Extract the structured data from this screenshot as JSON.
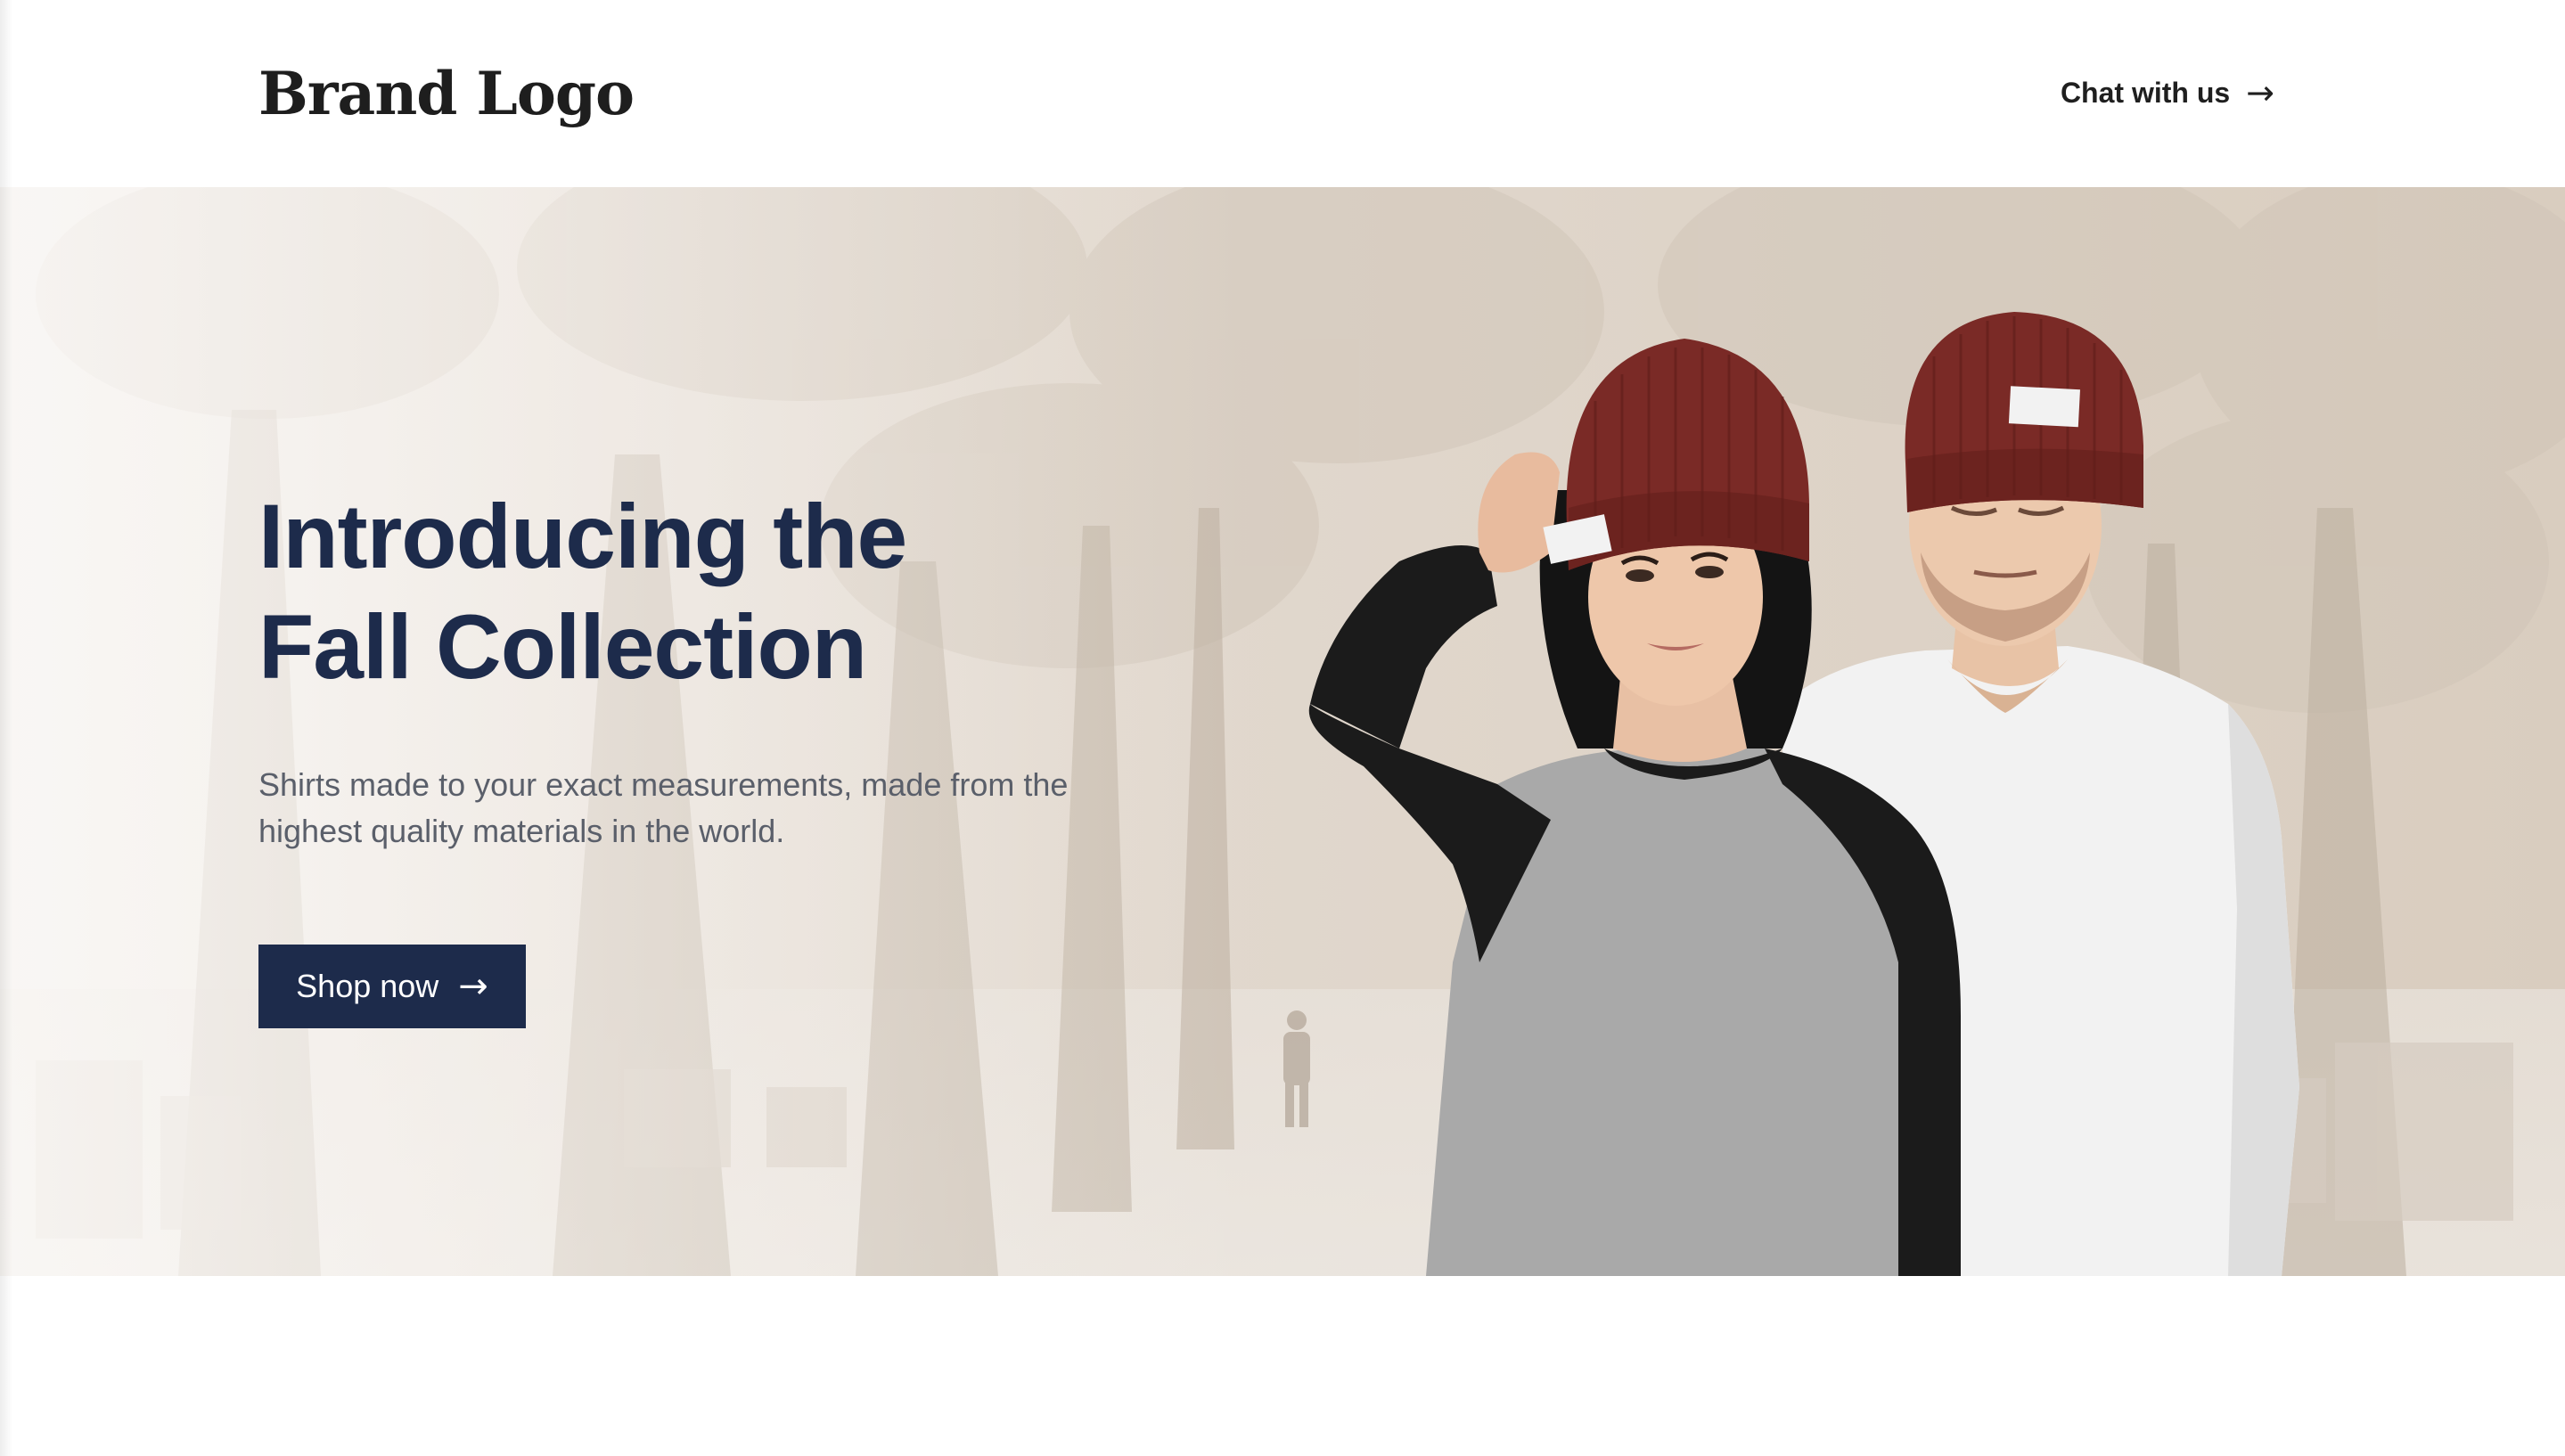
{
  "header": {
    "brand_logo": "Brand Logo",
    "chat_link_label": "Chat with us",
    "chat_arrow": "→"
  },
  "hero": {
    "title_line1": "Introducing the",
    "title_line2": "Fall Collection",
    "subtitle": "Shirts made to your exact measurements, made from the highest quality materials in the world.",
    "cta_label": "Shop now",
    "cta_arrow": "→",
    "image_description_icons": [
      "model-woman-beanie",
      "model-man-beanie"
    ]
  },
  "colors": {
    "navy": "#1d2b4b",
    "beanie_red": "#7a2a26",
    "hero_bg": "#e3dbd2",
    "text_gray": "#5a5f6a"
  }
}
